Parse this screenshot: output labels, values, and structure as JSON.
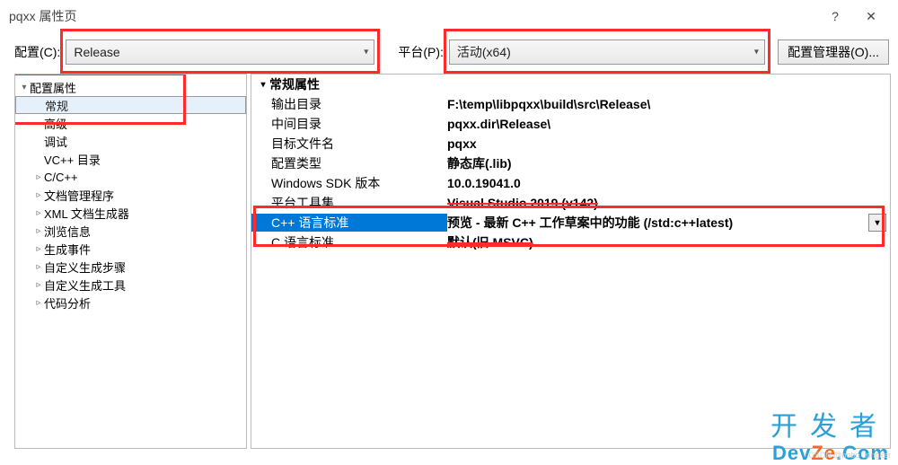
{
  "title": "pqxx 属性页",
  "help_icon": "?",
  "close_icon": "✕",
  "toolbar": {
    "config_label": "配置(C):",
    "config_value": "Release",
    "platform_label": "平台(P):",
    "platform_value": "活动(x64)",
    "manager_button": "配置管理器(O)..."
  },
  "tree": {
    "root": {
      "label": "配置属性",
      "expanded": true
    },
    "items": [
      {
        "label": "常规",
        "indent": 1,
        "arrow": "",
        "selected": true
      },
      {
        "label": "高级",
        "indent": 1,
        "arrow": ""
      },
      {
        "label": "调试",
        "indent": 1,
        "arrow": ""
      },
      {
        "label": "VC++ 目录",
        "indent": 1,
        "arrow": ""
      },
      {
        "label": "C/C++",
        "indent": 1,
        "arrow": "▹"
      },
      {
        "label": "文档管理程序",
        "indent": 1,
        "arrow": "▹"
      },
      {
        "label": "XML 文档生成器",
        "indent": 1,
        "arrow": "▹"
      },
      {
        "label": "浏览信息",
        "indent": 1,
        "arrow": "▹"
      },
      {
        "label": "生成事件",
        "indent": 1,
        "arrow": "▹"
      },
      {
        "label": "自定义生成步骤",
        "indent": 1,
        "arrow": "▹"
      },
      {
        "label": "自定义生成工具",
        "indent": 1,
        "arrow": "▹"
      },
      {
        "label": "代码分析",
        "indent": 1,
        "arrow": "▹"
      }
    ]
  },
  "grid": {
    "section": "常规属性",
    "rows": [
      {
        "k": "输出目录",
        "v": "F:\\temp\\libpqxx\\build\\src\\Release\\"
      },
      {
        "k": "中间目录",
        "v": "pqxx.dir\\Release\\"
      },
      {
        "k": "目标文件名",
        "v": "pqxx"
      },
      {
        "k": "配置类型",
        "v": "静态库(.lib)"
      },
      {
        "k": "Windows SDK 版本",
        "v": "10.0.19041.0"
      },
      {
        "k": "平台工具集",
        "v": "Visual Studio 2019 (v142)",
        "strike": true
      },
      {
        "k": "C++ 语言标准",
        "v": "预览 - 最新 C++ 工作草案中的功能 (/std:c++latest)",
        "selected": true,
        "dropdown": true
      },
      {
        "k": "C 语言标准",
        "v": "默认(旧 MSVC)",
        "strike": true
      }
    ]
  },
  "watermark": {
    "line1": "开发者",
    "line2_a": "Dev",
    "line2_b": "Ze",
    "line2_c": ".Com",
    "faint": "CSDN @bobo_longker"
  }
}
